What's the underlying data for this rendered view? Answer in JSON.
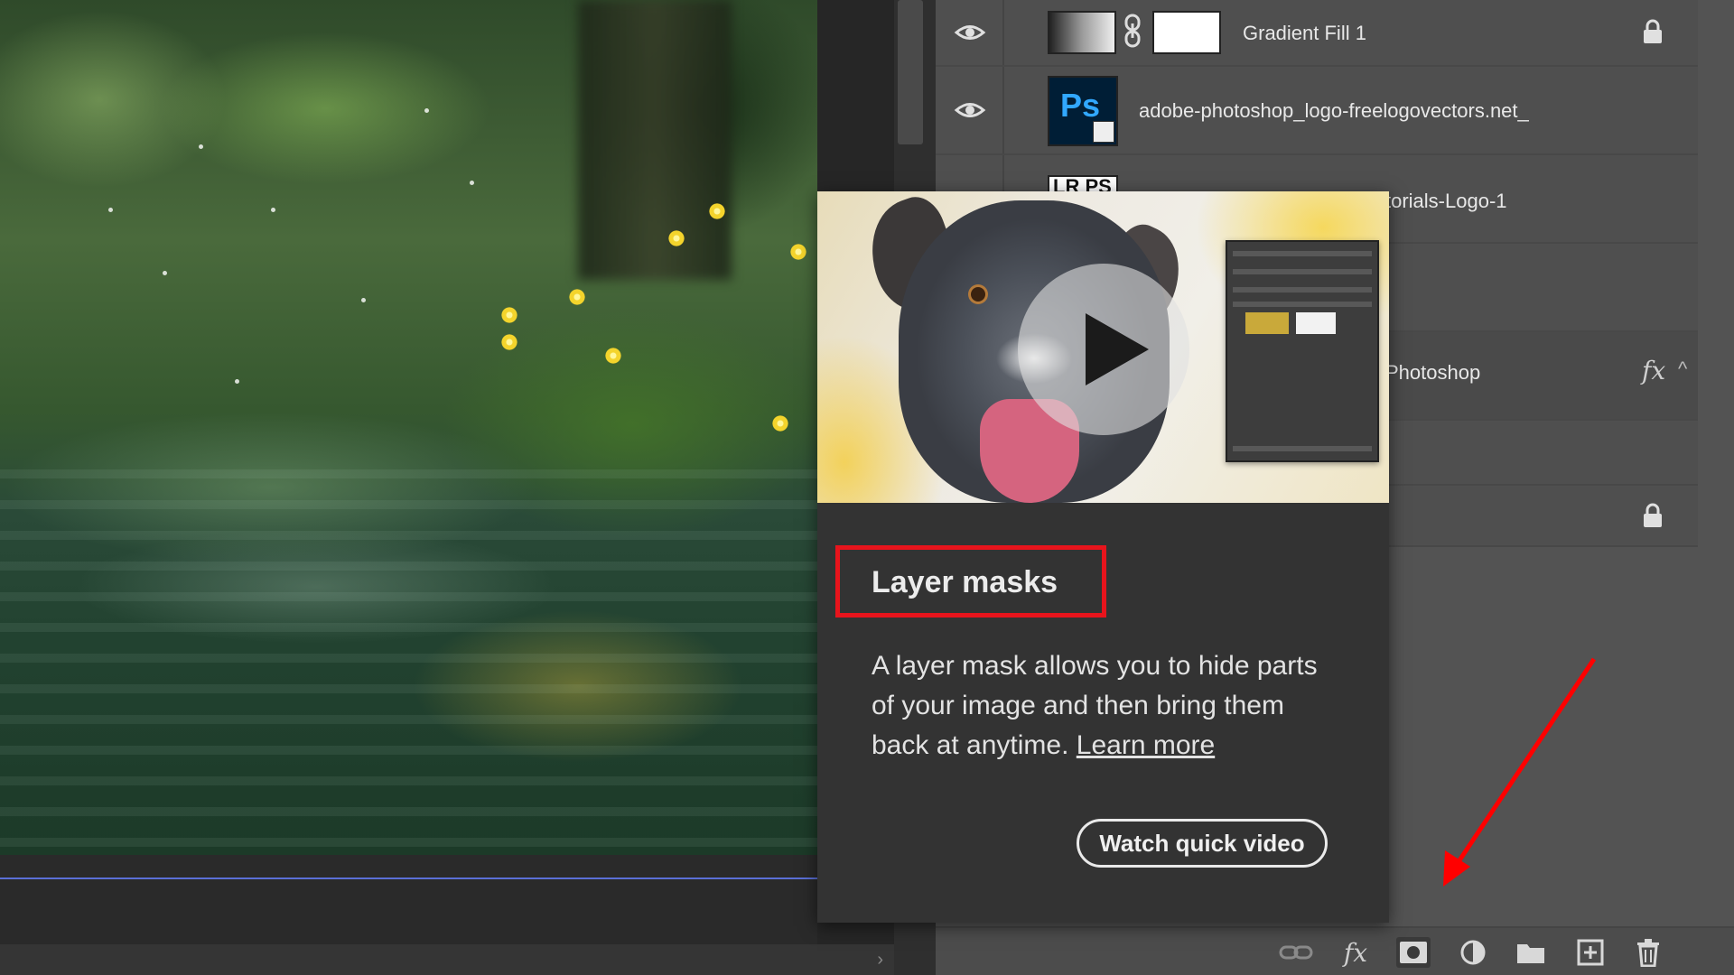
{
  "layers": [
    {
      "name": "Gradient Fill 1",
      "visible": true,
      "locked": true
    },
    {
      "name": "adobe-photoshop_logo-freelogovectors.net_",
      "visible": true,
      "locked": false,
      "thumb_text": "Ps"
    },
    {
      "name": "torials-Logo-1",
      "visible": false,
      "locked": false,
      "thumb_text": "LR PS"
    },
    {
      "name": "",
      "visible": false,
      "locked": false
    },
    {
      "name": "Photoshop",
      "visible": false,
      "locked": false,
      "has_fx": true,
      "fx_label": "fx"
    },
    {
      "name": "",
      "visible": false,
      "locked": false
    },
    {
      "name": "",
      "visible": false,
      "locked": true
    }
  ],
  "popup": {
    "title": "Layer masks",
    "description": "A layer mask allows you to hide parts of your image and then bring them back at anytime.",
    "learn_more": "Learn more",
    "watch_button": "Watch quick video"
  },
  "footer": {
    "fx_label": "fx"
  },
  "colors": {
    "highlight_box": "#e8141c",
    "annotation_arrow": "#ff0000",
    "panel_bg": "#535353",
    "popup_bg": "#333333"
  },
  "icons": [
    "eye-icon",
    "link-icon",
    "lock-icon",
    "play-icon",
    "link-layers-icon",
    "fx-icon",
    "add-mask-icon",
    "adjustment-layer-icon",
    "folder-icon",
    "new-layer-icon",
    "trash-icon"
  ]
}
